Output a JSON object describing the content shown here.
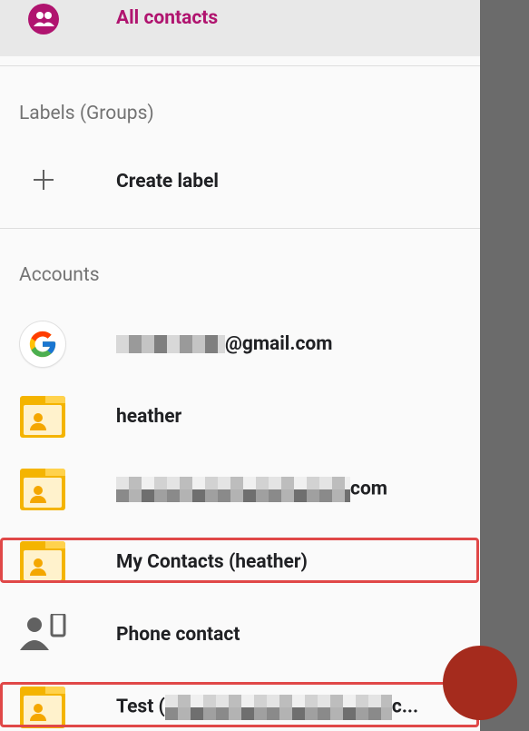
{
  "all_contacts": {
    "label": "All contacts",
    "icon": "people-icon",
    "color": "#b0146f"
  },
  "labels_section": {
    "header": "Labels (Groups)",
    "create_label": "Create label",
    "create_icon": "plus-icon"
  },
  "accounts_section": {
    "header": "Accounts",
    "items": [
      {
        "icon": "google-icon",
        "label_suffix": "@gmail.com",
        "redacted": true
      },
      {
        "icon": "folder-contact-icon",
        "label": "heather"
      },
      {
        "icon": "folder-contact-icon",
        "label_suffix": "com",
        "redacted": true
      },
      {
        "icon": "folder-contact-icon",
        "label": "My Contacts (heather)",
        "highlighted": true
      },
      {
        "icon": "phone-contact-icon",
        "label": "Phone contact"
      },
      {
        "icon": "folder-contact-icon",
        "label_prefix": "Test (",
        "label_suffix": "c...",
        "redacted": true,
        "highlighted": true
      }
    ]
  },
  "colors": {
    "highlight": "#e04848",
    "fab": "#a52b1d",
    "scrim": "#6b6b6b"
  }
}
